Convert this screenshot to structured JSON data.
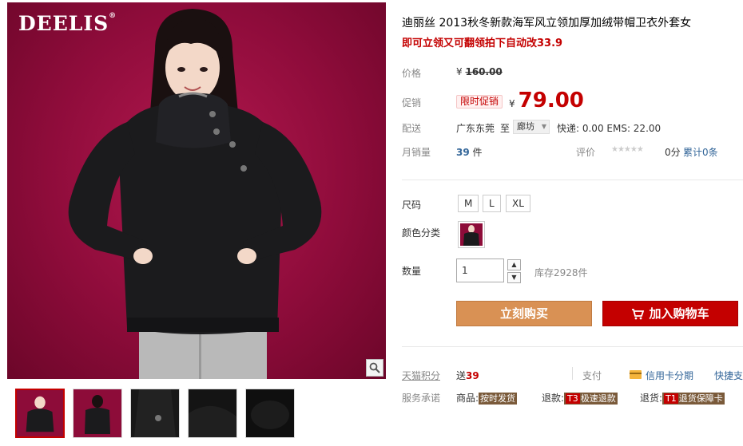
{
  "gallery": {
    "brand": "DEELIS",
    "brand_mark": "®",
    "thumb_count": 5
  },
  "product": {
    "title": "迪丽丝 2013秋冬新款海军风立领加厚加绒带帽卫衣外套女",
    "subtitle": "即可立领又可翻领拍下自动改33.9"
  },
  "price": {
    "label": "价格",
    "currency": "¥",
    "original": "160.00"
  },
  "promo": {
    "label": "促销",
    "tag": "限时促销",
    "currency": "¥",
    "price": "79.00"
  },
  "shipping": {
    "label": "配送",
    "from": "广东东莞",
    "to_word": "至",
    "destination": "廊坊",
    "fee": "快递: 0.00 EMS: 22.00"
  },
  "sales": {
    "label": "月销量",
    "count": "39",
    "unit": "件",
    "rating_label": "评价",
    "stars": "★★★★★",
    "score": "0分",
    "reviews": "累计0条"
  },
  "size": {
    "label": "尺码",
    "options": [
      "M",
      "L",
      "XL"
    ]
  },
  "color": {
    "label": "颜色分类"
  },
  "quantity": {
    "label": "数量",
    "value": "1",
    "up": "▲",
    "down": "▼",
    "stock": "库存2928件"
  },
  "actions": {
    "buy": "立刻购买",
    "cart": "加入购物车"
  },
  "points": {
    "label": "天猫积分",
    "prefix": "送",
    "value": "39"
  },
  "payment": {
    "label": "支付",
    "installment": "信用卡分期",
    "express": "快捷支付"
  },
  "services": {
    "label": "服务承诺",
    "items": [
      {
        "prefix": "商品:",
        "code": "",
        "text": "按时发货"
      },
      {
        "prefix": "退款:",
        "code": "T3",
        "text": "极速退款"
      },
      {
        "prefix": "退货:",
        "code": "T1",
        "text": "退货保障卡"
      }
    ]
  },
  "colors": {
    "accent": "#c40000",
    "buy_button": "#d99154",
    "link": "#336699",
    "photo_bg": "#9a0f42"
  },
  "icons": {
    "zoom": "magnifier-icon",
    "cart": "shopping-cart-icon",
    "card": "credit-card-icon"
  }
}
